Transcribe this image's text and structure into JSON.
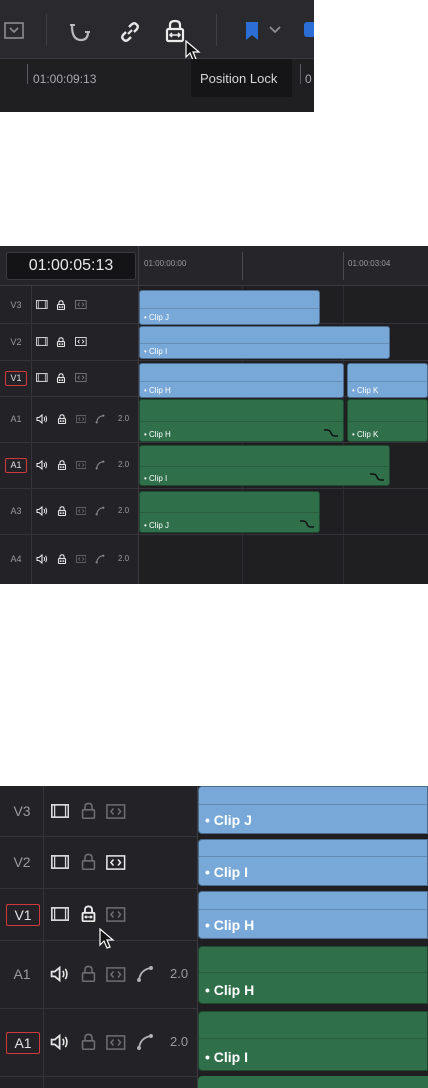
{
  "toolbar": {
    "timecode": "01:00:09:13",
    "tooltip": "Position Lock",
    "icons": [
      "snapping-icon",
      "linked-selection-icon",
      "position-lock-icon",
      "flag-icon",
      "chevron-down-icon"
    ]
  },
  "timeline": {
    "current_timecode": "01:00:05:13",
    "ruler": [
      "01:00:00:00",
      "01:00:03:04"
    ],
    "tracks": [
      {
        "name": "V3",
        "type": "video",
        "dest": false
      },
      {
        "name": "V2",
        "type": "video",
        "dest": false
      },
      {
        "name": "V1",
        "type": "video",
        "dest": true
      },
      {
        "name": "A1",
        "type": "audio",
        "dest": false,
        "channels": "2.0"
      },
      {
        "name": "A1",
        "type": "audio",
        "dest": true,
        "channels": "2.0"
      },
      {
        "name": "A3",
        "type": "audio",
        "dest": false,
        "channels": "2.0"
      },
      {
        "name": "A4",
        "type": "audio",
        "dest": false,
        "channels": "2.0"
      }
    ],
    "clips": [
      "Clip J",
      "Clip I",
      "Clip H",
      "Clip K",
      "Clip H",
      "Clip K",
      "Clip I",
      "Clip J"
    ]
  },
  "zoom": {
    "tracks": [
      {
        "name": "V3",
        "type": "video",
        "dest": false
      },
      {
        "name": "V2",
        "type": "video",
        "dest": false
      },
      {
        "name": "V1",
        "type": "video",
        "dest": true
      },
      {
        "name": "A1",
        "type": "audio",
        "dest": false,
        "channels": "2.0"
      },
      {
        "name": "A1",
        "type": "audio",
        "dest": true,
        "channels": "2.0"
      }
    ],
    "clips": [
      "Clip J",
      "Clip I",
      "Clip H",
      "Clip H",
      "Clip I"
    ]
  },
  "colors": {
    "panel": "#1f1f22",
    "header": "#26262a",
    "video_clip": "#78a8d8",
    "audio_clip": "#2f6f4a",
    "dest_outline": "#d13a3a",
    "flag": "#2b6fd6"
  }
}
